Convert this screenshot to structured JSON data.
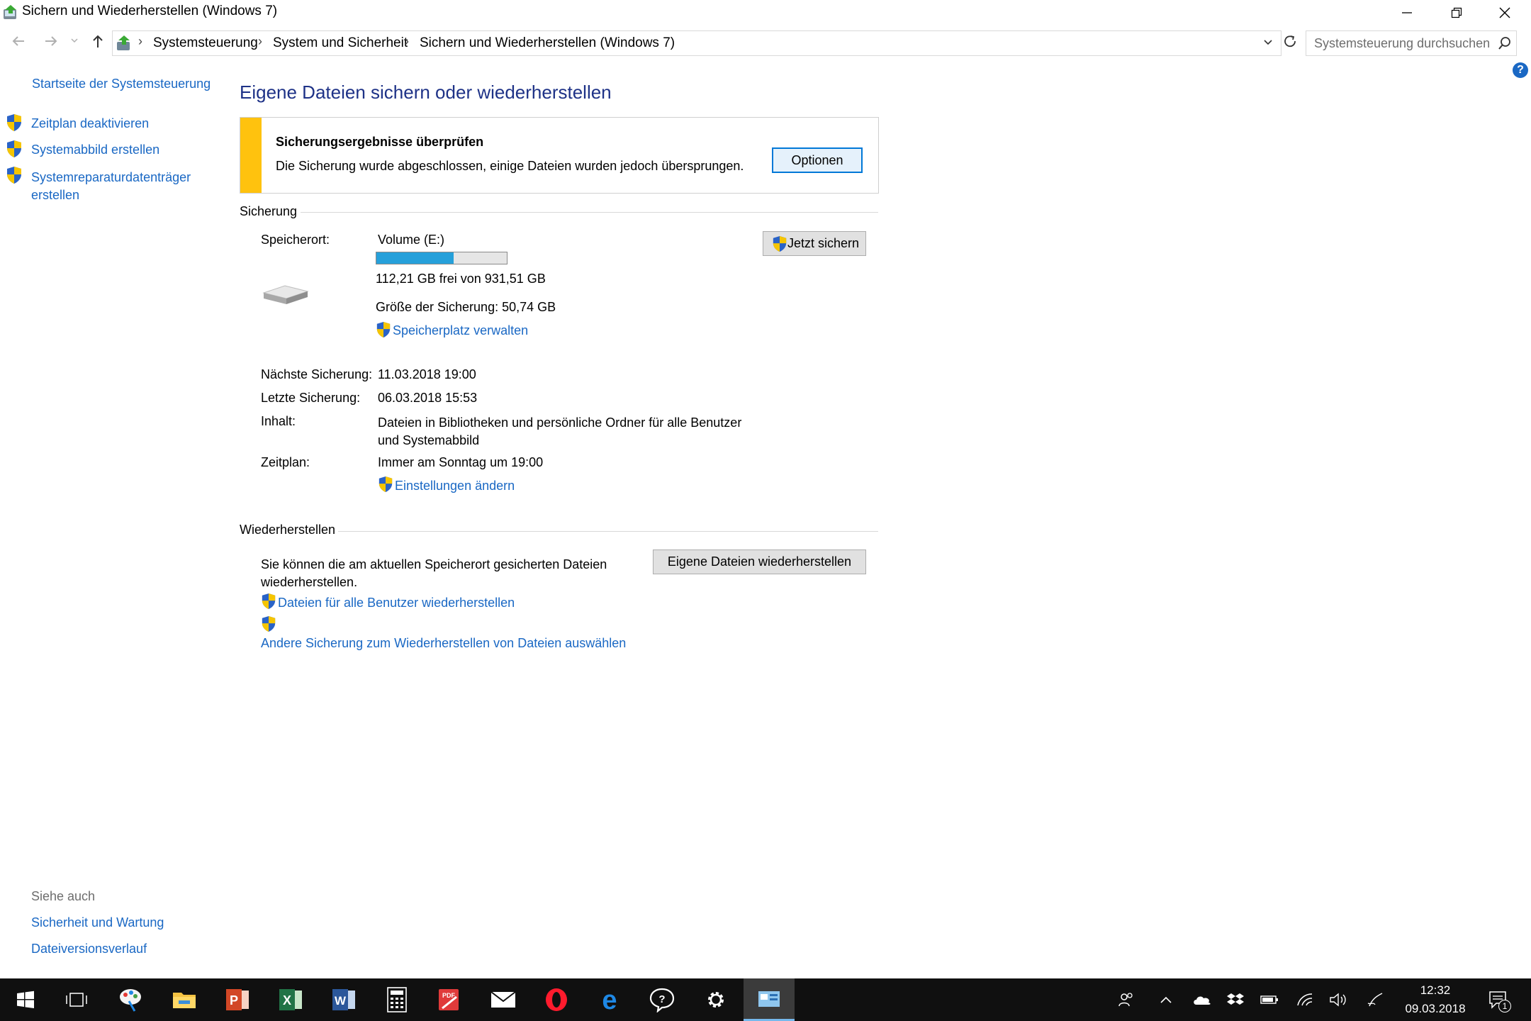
{
  "window": {
    "title": "Sichern und Wiederherstellen (Windows 7)",
    "controls": [
      "minimize-icon",
      "restore-icon",
      "close-icon"
    ]
  },
  "address": {
    "breadcrumbs": [
      "Systemsteuerung",
      "System und Sicherheit",
      "Sichern und Wiederherstellen (Windows 7)"
    ],
    "search_placeholder": "Systemsteuerung durchsuchen"
  },
  "sidebar": {
    "home": "Startseite der Systemsteuerung",
    "items": [
      {
        "label": "Zeitplan deaktivieren",
        "icon": "shield-icon"
      },
      {
        "label": "Systemabbild erstellen",
        "icon": "shield-icon"
      },
      {
        "label_line1": "Systemreparaturdatenträger",
        "label_line2": "erstellen",
        "icon": "shield-icon"
      }
    ],
    "see_also": {
      "title": "Siehe auch",
      "links": [
        "Sicherheit und Wartung",
        "Dateiversionsverlauf"
      ]
    }
  },
  "main": {
    "heading": "Eigene Dateien sichern oder wiederherstellen",
    "notice": {
      "title": "Sicherungsergebnisse überprüfen",
      "text": "Die Sicherung wurde abgeschlossen, einige Dateien wurden jedoch übersprungen.",
      "button": "Optionen"
    },
    "backup": {
      "section_title": "Sicherung",
      "location_label": "Speicherort:",
      "location_value": "Volume (E:)",
      "usage_fraction": 0.59,
      "free_text": "112,21 GB frei von 931,51 GB",
      "size_text": "Größe der Sicherung: 50,74 GB",
      "manage_link": "Speicherplatz verwalten",
      "backup_now_button": "Jetzt sichern",
      "next_label": "Nächste Sicherung:",
      "next_value": "11.03.2018 19:00",
      "last_label": "Letzte Sicherung:",
      "last_value": "06.03.2018 15:53",
      "content_label": "Inhalt:",
      "content_value_line1": "Dateien in Bibliotheken und persönliche Ordner für alle Benutzer",
      "content_value_line2": "und Systemabbild",
      "schedule_label": "Zeitplan:",
      "schedule_value": "Immer am Sonntag um 19:00",
      "settings_link": "Einstellungen ändern"
    },
    "restore": {
      "section_title": "Wiederherstellen",
      "text_line1": "Sie können die am aktuellen Speicherort gesicherten Dateien",
      "text_line2": "wiederherstellen.",
      "restore_button": "Eigene Dateien wiederherstellen",
      "all_users_link": "Dateien für alle Benutzer wiederherstellen",
      "other_backup_link": "Andere Sicherung zum Wiederherstellen von Dateien auswählen"
    }
  },
  "taskbar": {
    "apps": [
      "start-icon",
      "task-view-icon",
      "paint-icon",
      "file-explorer-icon",
      "powerpoint-icon",
      "excel-icon",
      "word-icon",
      "calculator-icon",
      "pdf-editor-icon",
      "mail-icon",
      "opera-icon",
      "edge-icon",
      "feedback-icon",
      "settings-icon",
      "control-panel-icon"
    ],
    "clock_time": "12:32",
    "clock_date": "09.03.2018",
    "notification_count": "1"
  },
  "colors": {
    "link": "#1a68c4",
    "heading": "#1e3287",
    "notice_accent": "#ffc20e",
    "progress": "#26a0da",
    "taskbar": "#101010"
  }
}
